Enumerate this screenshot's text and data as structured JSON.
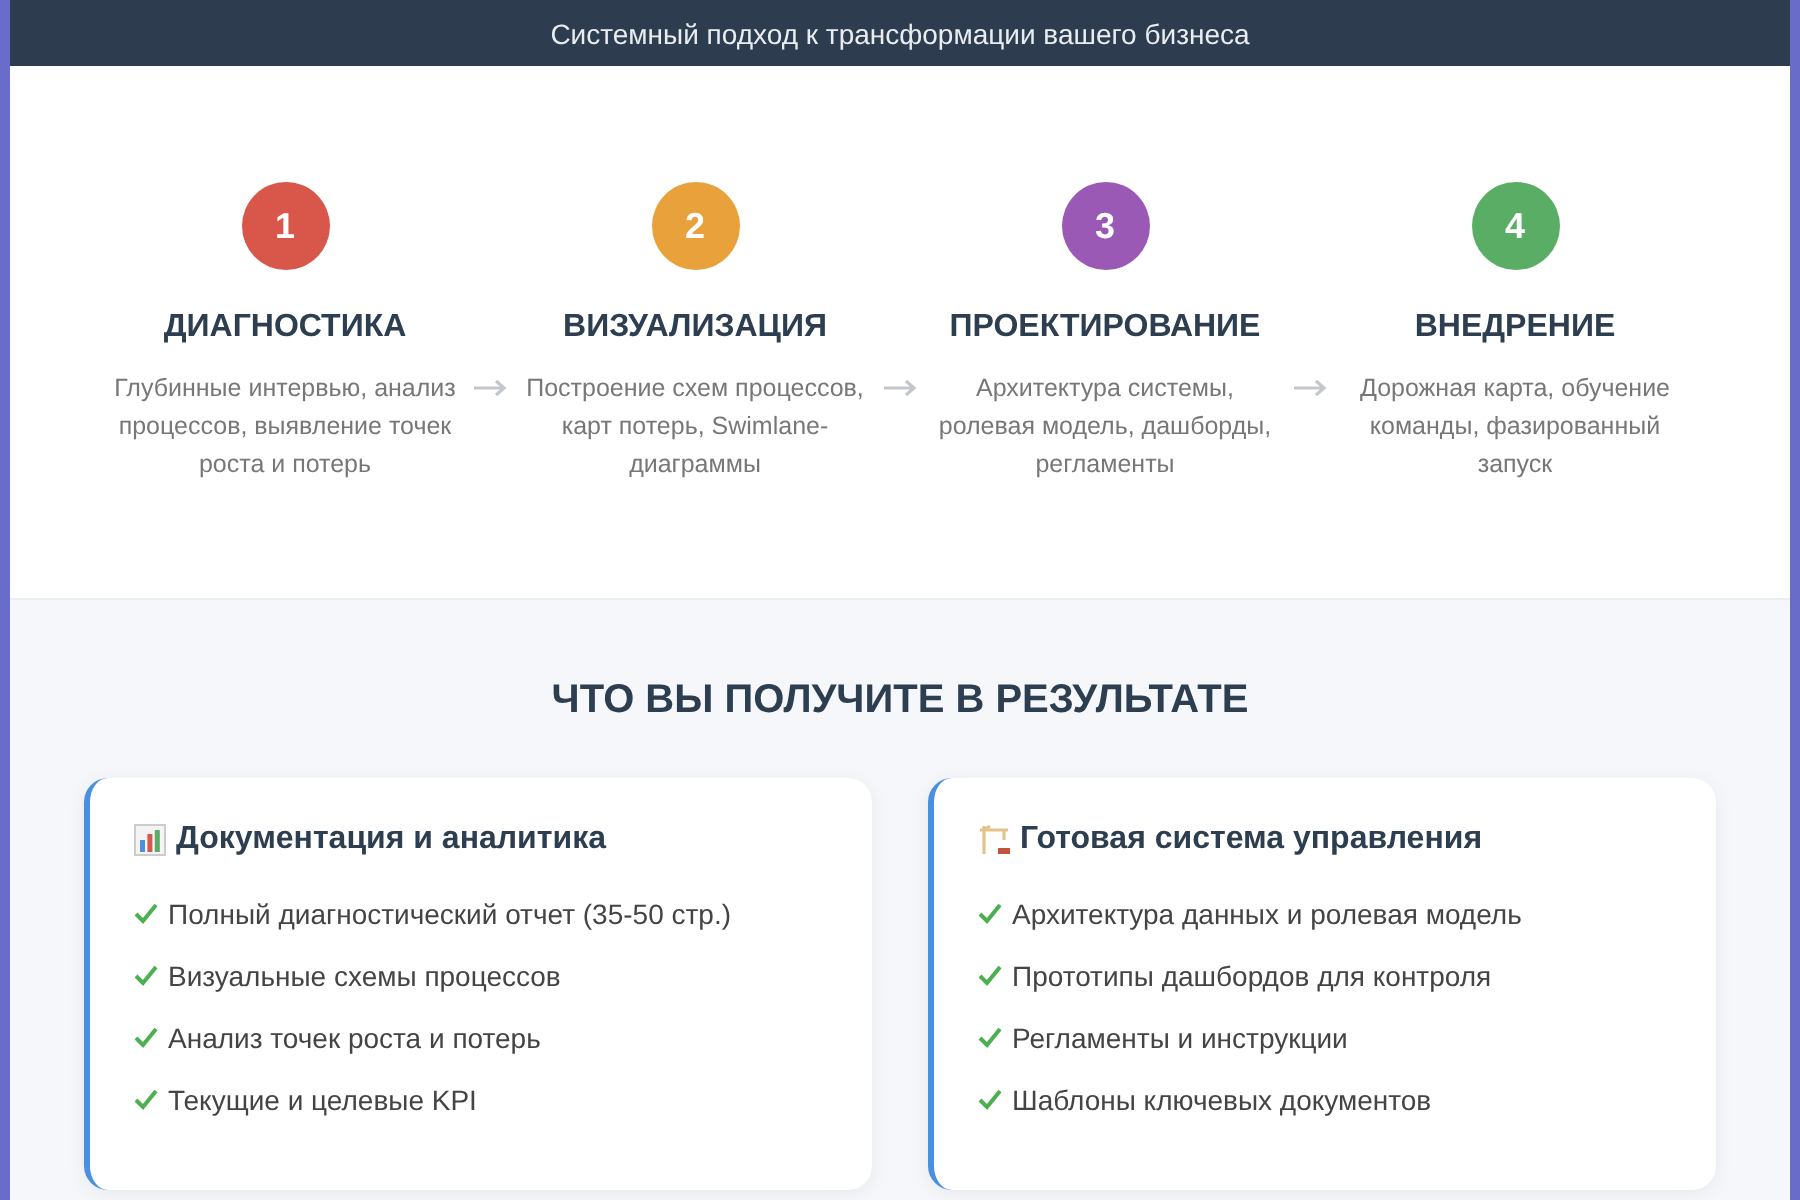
{
  "header": {
    "subtitle": "Системный подход к трансформации вашего бизнеса"
  },
  "steps": [
    {
      "number": "1",
      "title": "ДИАГНОСТИКА",
      "description": "Глубинные интервью, анализ процессов, выявление точек роста и потерь",
      "color": "#d9574a"
    },
    {
      "number": "2",
      "title": "ВИЗУАЛИЗАЦИЯ",
      "description": "Построение схем процессов, карт потерь, Swimlane-диаграммы",
      "color": "#e9a23b"
    },
    {
      "number": "3",
      "title": "ПРОЕКТИРОВАНИЕ",
      "description": "Архитектура системы, ролевая модель, дашборды, регламенты",
      "color": "#9b59b6"
    },
    {
      "number": "4",
      "title": "ВНЕДРЕНИЕ",
      "description": "Дорожная карта, обучение команды, фазированный запуск",
      "color": "#5aad64"
    }
  ],
  "results": {
    "title": "ЧТО ВЫ ПОЛУЧИТЕ В РЕЗУЛЬТАТЕ",
    "cards": [
      {
        "kind": "chart",
        "title": "Документация и аналитика",
        "items": [
          "Полный диагностический отчет (35-50 стр.)",
          "Визуальные схемы процессов",
          "Анализ точек роста и потерь",
          "Текущие и целевые KPI"
        ]
      },
      {
        "kind": "crane",
        "title": "Готовая система управления",
        "items": [
          "Архитектура данных и ролевая модель",
          "Прототипы дашбордов для контроля",
          "Регламенты и инструкции",
          "Шаблоны ключевых документов"
        ]
      }
    ]
  }
}
